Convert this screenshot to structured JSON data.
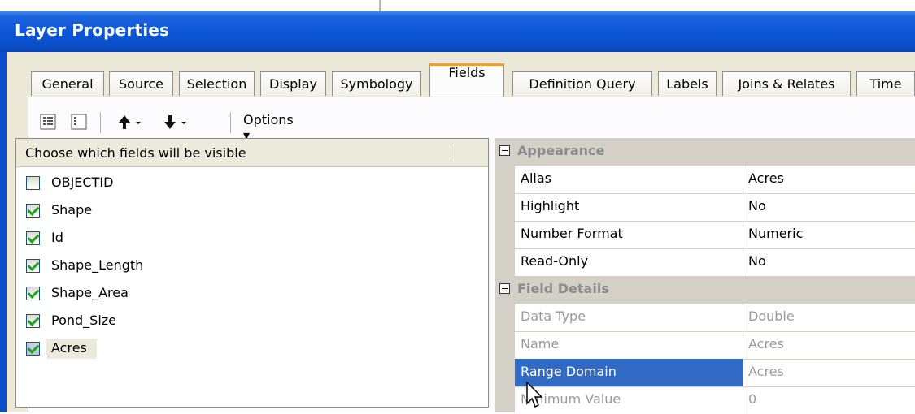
{
  "window": {
    "title": "Layer Properties"
  },
  "tabs": [
    {
      "label": "General"
    },
    {
      "label": "Source"
    },
    {
      "label": "Selection"
    },
    {
      "label": "Display"
    },
    {
      "label": "Symbology"
    },
    {
      "label": "Fields",
      "active": true
    },
    {
      "label": "Definition Query"
    },
    {
      "label": "Labels"
    },
    {
      "label": "Joins & Relates"
    },
    {
      "label": "Time"
    }
  ],
  "toolbar": {
    "icons": [
      "list-view-icon",
      "grid-view-icon",
      "move-up-icon",
      "move-down-icon"
    ],
    "options_label": "Options ▾"
  },
  "fields_list": {
    "header": "Choose which fields will be visible",
    "items": [
      {
        "name": "OBJECTID",
        "checked": false
      },
      {
        "name": "Shape",
        "checked": true
      },
      {
        "name": "Id",
        "checked": true
      },
      {
        "name": "Shape_Length",
        "checked": true
      },
      {
        "name": "Shape_Area",
        "checked": true
      },
      {
        "name": "Pond_Size",
        "checked": true
      },
      {
        "name": "Acres",
        "checked": true,
        "selected": true
      }
    ]
  },
  "properties": {
    "appearance": {
      "title": "Appearance",
      "rows": [
        {
          "name": "Alias",
          "value": "Acres"
        },
        {
          "name": "Highlight",
          "value": "No"
        },
        {
          "name": "Number Format",
          "value": "Numeric"
        },
        {
          "name": "Read-Only",
          "value": "No"
        }
      ]
    },
    "field_details": {
      "title": "Field Details",
      "rows": [
        {
          "name": "Data Type",
          "value": "Double"
        },
        {
          "name": "Name",
          "value": "Acres"
        },
        {
          "name": "Range Domain",
          "value": "Acres"
        },
        {
          "name": "Minimum Value",
          "value": "0"
        }
      ]
    }
  },
  "colors": {
    "titlebar": "#0a55d6",
    "selection": "#316ac5",
    "active_tab_accent": "#e8a236",
    "checkmark": "#21a121"
  }
}
